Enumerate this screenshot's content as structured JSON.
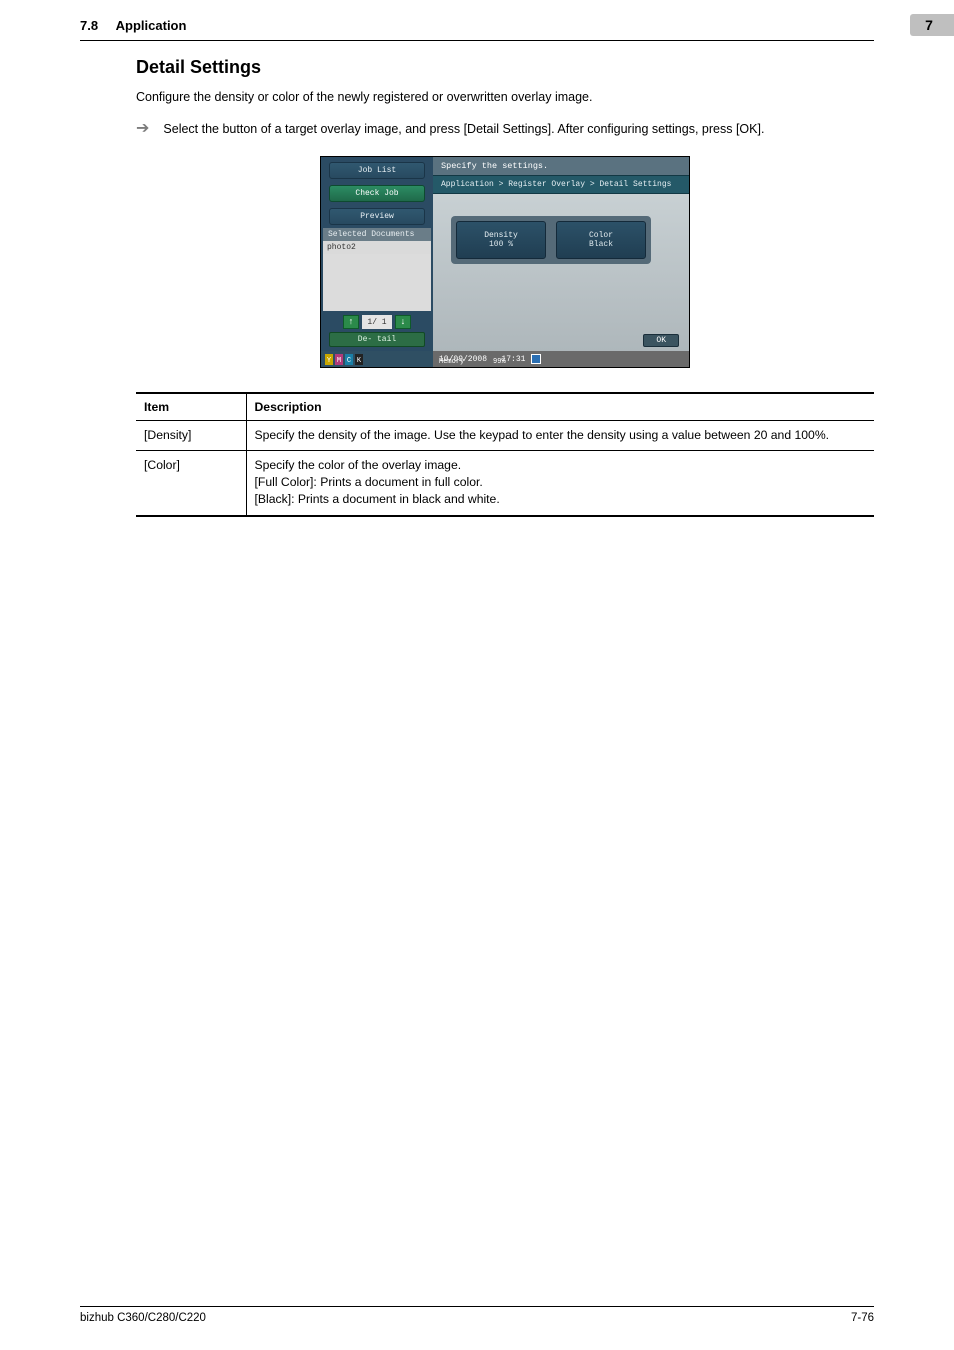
{
  "header": {
    "section_no": "7.8",
    "section_name": "Application",
    "chapter_no": "7"
  },
  "section_title": "Detail Settings",
  "intro_text": "Configure the density or color of the newly registered or overwritten overlay image.",
  "instruction_text": "Select the button of a target overlay image, and press [Detail Settings]. After configuring settings, press [OK].",
  "screenshot": {
    "top_instruction": "Specify the settings.",
    "breadcrumb": "Application > Register Overlay > Detail Settings",
    "left": {
      "job_list": "Job List",
      "check_job": "Check Job",
      "preview": "Preview",
      "selected_docs_label": "Selected Documents",
      "doc1": "photo2",
      "pager": "1/  1",
      "detail": "De-\ntail"
    },
    "panel": {
      "density_label": "Density",
      "density_val": "100  %",
      "color_label": "Color",
      "color_val": "Black"
    },
    "footer": {
      "date": "10/09/2008",
      "time": "17:31",
      "mem_label": "Memory",
      "mem_val": "99%",
      "ok": "OK"
    },
    "toners": {
      "y": "Y",
      "m": "M",
      "c": "C",
      "k": "K"
    }
  },
  "table": {
    "header_item": "Item",
    "header_desc": "Description",
    "rows": [
      {
        "item": "[Density]",
        "desc": "Specify the density of the image. Use the keypad to enter the density using a value between 20 and 100%."
      },
      {
        "item": "[Color]",
        "desc": "Specify the color of the overlay image.\n[Full Color]: Prints a document in full color.\n[Black]: Prints a document in black and white."
      }
    ]
  },
  "footer": {
    "model": "bizhub C360/C280/C220",
    "page": "7-76"
  }
}
